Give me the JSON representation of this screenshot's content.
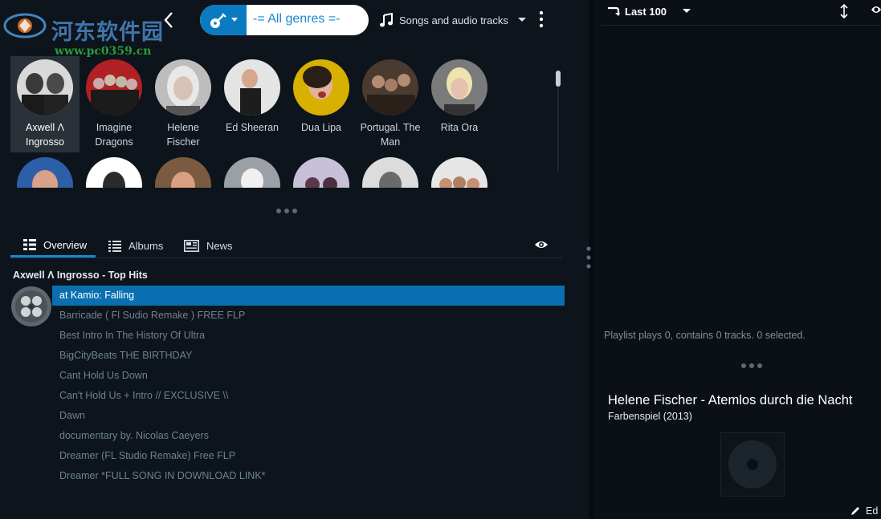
{
  "watermark": {
    "site_name": "河东软件园",
    "url": "www.pc0359.cn"
  },
  "toolbar": {
    "back_icon": "chevron-left-icon",
    "genre_icon": "guitar-icon",
    "genre_filter": "-= All genres =-",
    "mode_icon": "music-note-icon",
    "mode_label": "Songs and audio tracks",
    "more_icon": "vertical-dots-icon"
  },
  "artists": [
    {
      "name": "Axwell Λ Ingrosso",
      "selected": true
    },
    {
      "name": "Imagine Dragons"
    },
    {
      "name": "Helene Fischer"
    },
    {
      "name": "Ed Sheeran"
    },
    {
      "name": "Dua Lipa"
    },
    {
      "name": "Portugal. The Man"
    },
    {
      "name": "Rita Ora"
    },
    {
      "name": ""
    },
    {
      "name": ""
    },
    {
      "name": ""
    },
    {
      "name": ""
    },
    {
      "name": ""
    },
    {
      "name": ""
    },
    {
      "name": ""
    }
  ],
  "tabs": [
    {
      "label": "Overview",
      "icon": "list-icon",
      "active": true
    },
    {
      "label": "Albums",
      "icon": "list-lines-icon"
    },
    {
      "label": "News",
      "icon": "newspaper-icon"
    }
  ],
  "top_hits": {
    "title": "Axwell Λ Ingrosso - Top Hits",
    "tracks": [
      "at Kamio: Falling",
      "Barricade ( Fl Sudio Remake ) FREE FLP",
      "Best Intro In The History Of Ultra",
      "BigCityBeats THE BIRTHDAY",
      "Cant Hold Us Down",
      "Can't Hold Us + Intro // EXCLUSIVE \\\\",
      "Dawn",
      "documentary by. Nicolas Caeyers",
      "Dreamer (FL Studio Remake) Free FLP",
      "Dreamer *FULL SONG IN DOWNLOAD LINK*"
    ],
    "selected_index": 0
  },
  "playlist": {
    "filter_label": "Last 100",
    "info": "Playlist plays 0, contains 0 tracks. 0 selected."
  },
  "now_playing": {
    "title": "Helene Fischer - Atemlos durch die Nacht",
    "album": "Farbenspiel (2013)",
    "edit_label": "Ed"
  },
  "colors": {
    "accent": "#0a6fb0",
    "background": "#0d141b",
    "track_text": "#6f8290"
  }
}
